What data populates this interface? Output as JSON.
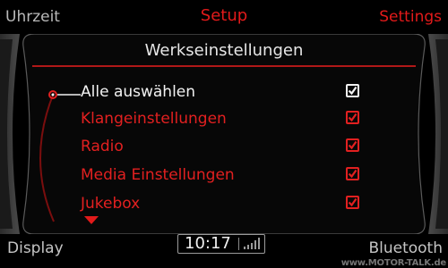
{
  "header": {
    "left_label": "Uhrzeit",
    "center_label": "Setup",
    "right_label": "Settings"
  },
  "footer": {
    "left_label": "Display",
    "right_label": "Bluetooth",
    "clock": "10:17",
    "watermark": "www.MOTOR-TALK.de"
  },
  "panel": {
    "title": "Werkseinstellungen",
    "items": [
      {
        "label": "Alle auswählen",
        "checked": true,
        "selected": true
      },
      {
        "label": "Klangeinstellungen",
        "checked": true,
        "selected": false
      },
      {
        "label": "Radio",
        "checked": true,
        "selected": false
      },
      {
        "label": "Media Einstellungen",
        "checked": true,
        "selected": false
      },
      {
        "label": "Jukebox",
        "checked": true,
        "selected": false
      }
    ]
  },
  "colors": {
    "accent_red": "#e21a1a",
    "text_white": "#f2f2f2",
    "text_grey": "#c4c4c4",
    "background": "#000000"
  }
}
